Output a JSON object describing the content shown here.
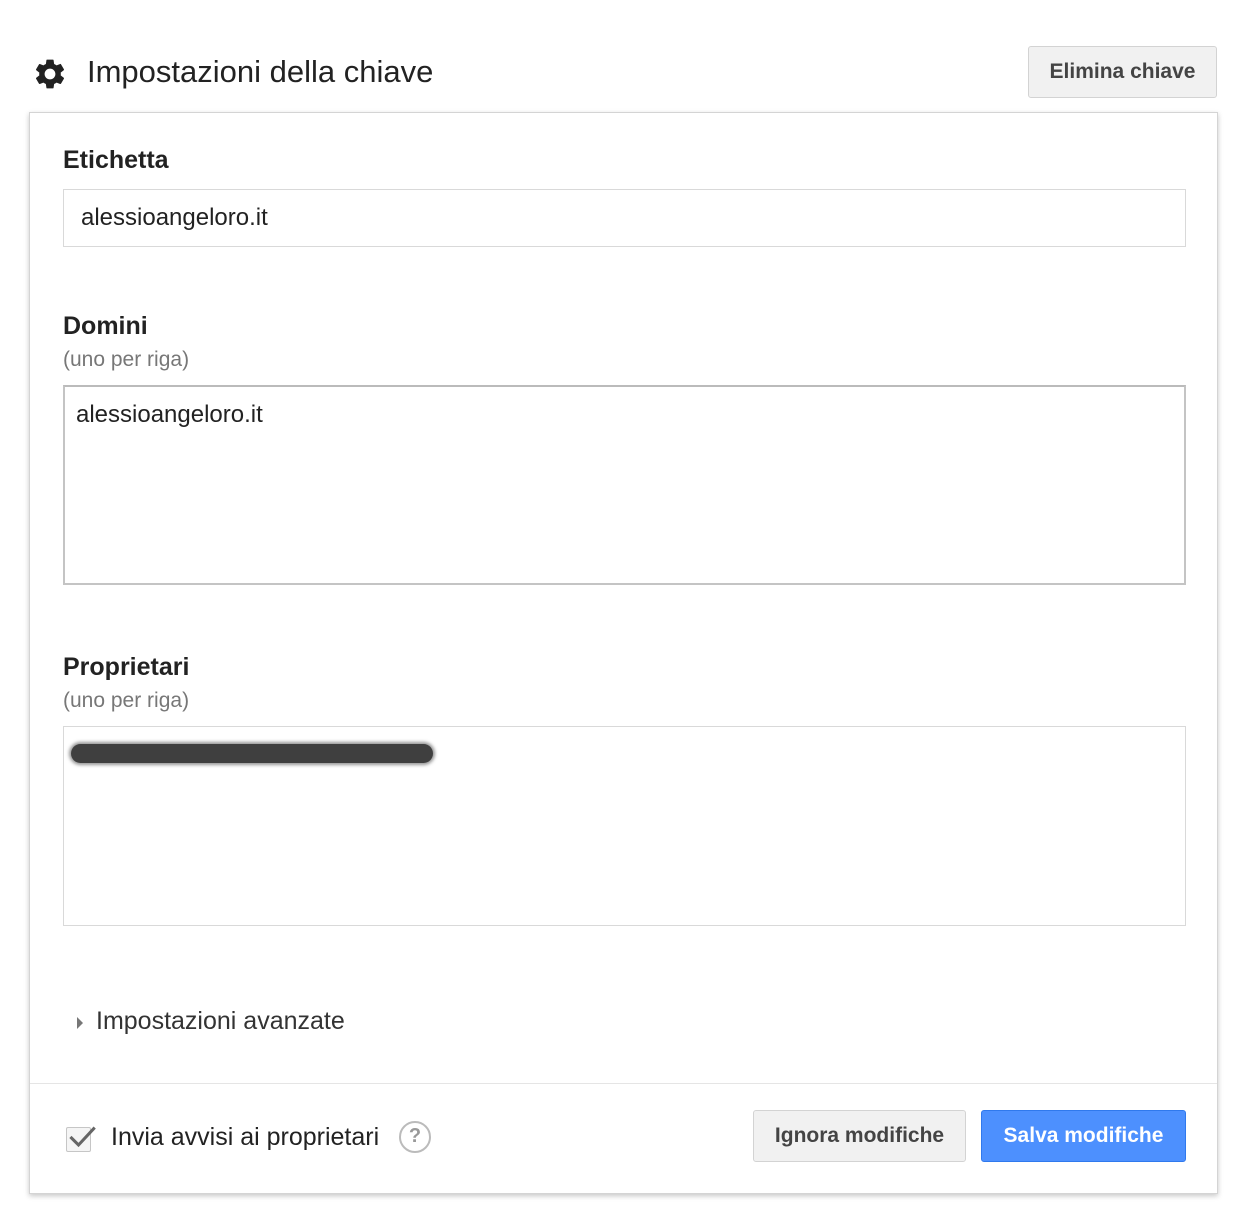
{
  "header": {
    "icon": "gear-icon",
    "title": "Impostazioni della chiave",
    "delete_label": "Elimina chiave"
  },
  "form": {
    "label_field": {
      "label": "Etichetta",
      "value": "alessioangeloro.it"
    },
    "domains": {
      "label": "Domini",
      "hint": "(uno per riga)",
      "value": "alessioangeloro.it"
    },
    "owners": {
      "label": "Proprietari",
      "hint": "(uno per riga)",
      "value_redacted": true
    },
    "advanced": {
      "label": "Impostazioni avanzate",
      "expanded": false
    }
  },
  "footer": {
    "notify_owners": {
      "label": "Invia avvisi ai proprietari",
      "checked": true
    },
    "help_icon": "help-circle-icon",
    "help_glyph": "?",
    "ignore_label": "Ignora modifiche",
    "save_label": "Salva modifiche"
  },
  "colors": {
    "primary_button": "#4d90fe",
    "secondary_button": "#f1f1f1",
    "border": "#d4d4d4"
  }
}
